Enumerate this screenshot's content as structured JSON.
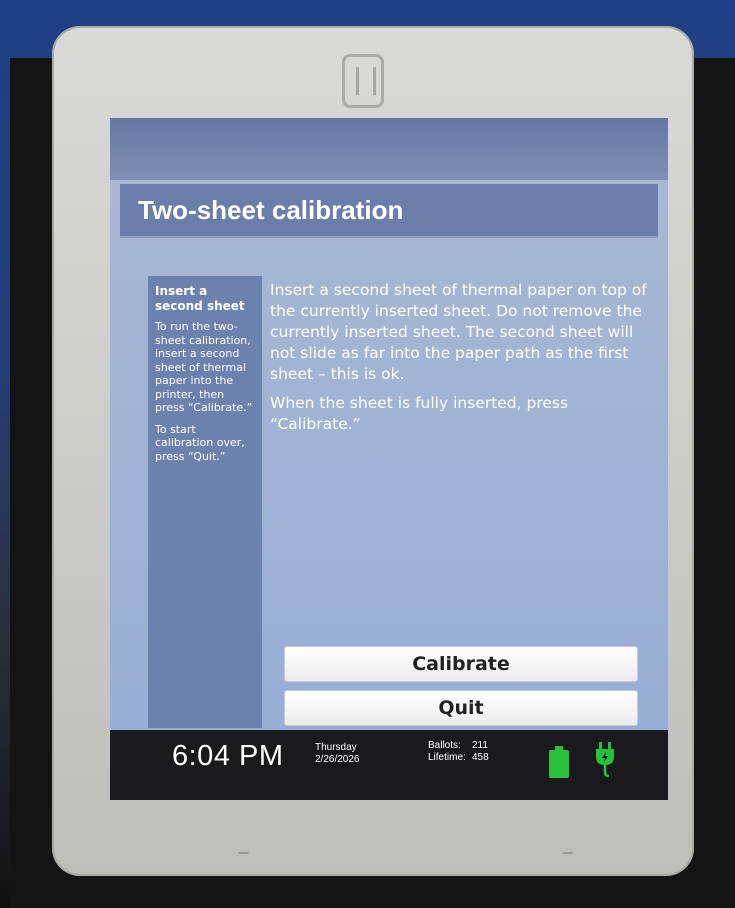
{
  "screen": {
    "title": "Two-sheet calibration",
    "sidebar": {
      "heading": "Insert a second sheet",
      "paragraph1": "To run the two-sheet calibration, insert a second sheet of thermal paper into the printer, then press “Calibrate.”",
      "paragraph2": "To start calibration over, press “Quit.”"
    },
    "main": {
      "paragraph1": "Insert a second sheet of thermal paper on top of the currently inserted sheet. Do not remove the currently inserted sheet. The second sheet will not slide as far into the paper path as the first sheet – this is ok.",
      "paragraph2": "When the sheet is fully inserted, press “Calibrate.”"
    },
    "buttons": {
      "calibrate": "Calibrate",
      "quit": "Quit"
    }
  },
  "status_bar": {
    "time": "6:04 PM",
    "day": "Thursday",
    "date": "2/26/2026",
    "ballots_label": "Ballots:",
    "ballots_value": "211",
    "lifetime_label": "Lifetime:",
    "lifetime_value": "458",
    "icons": [
      "battery-icon",
      "power-plug-icon"
    ],
    "icon_color": "#27c13c"
  }
}
